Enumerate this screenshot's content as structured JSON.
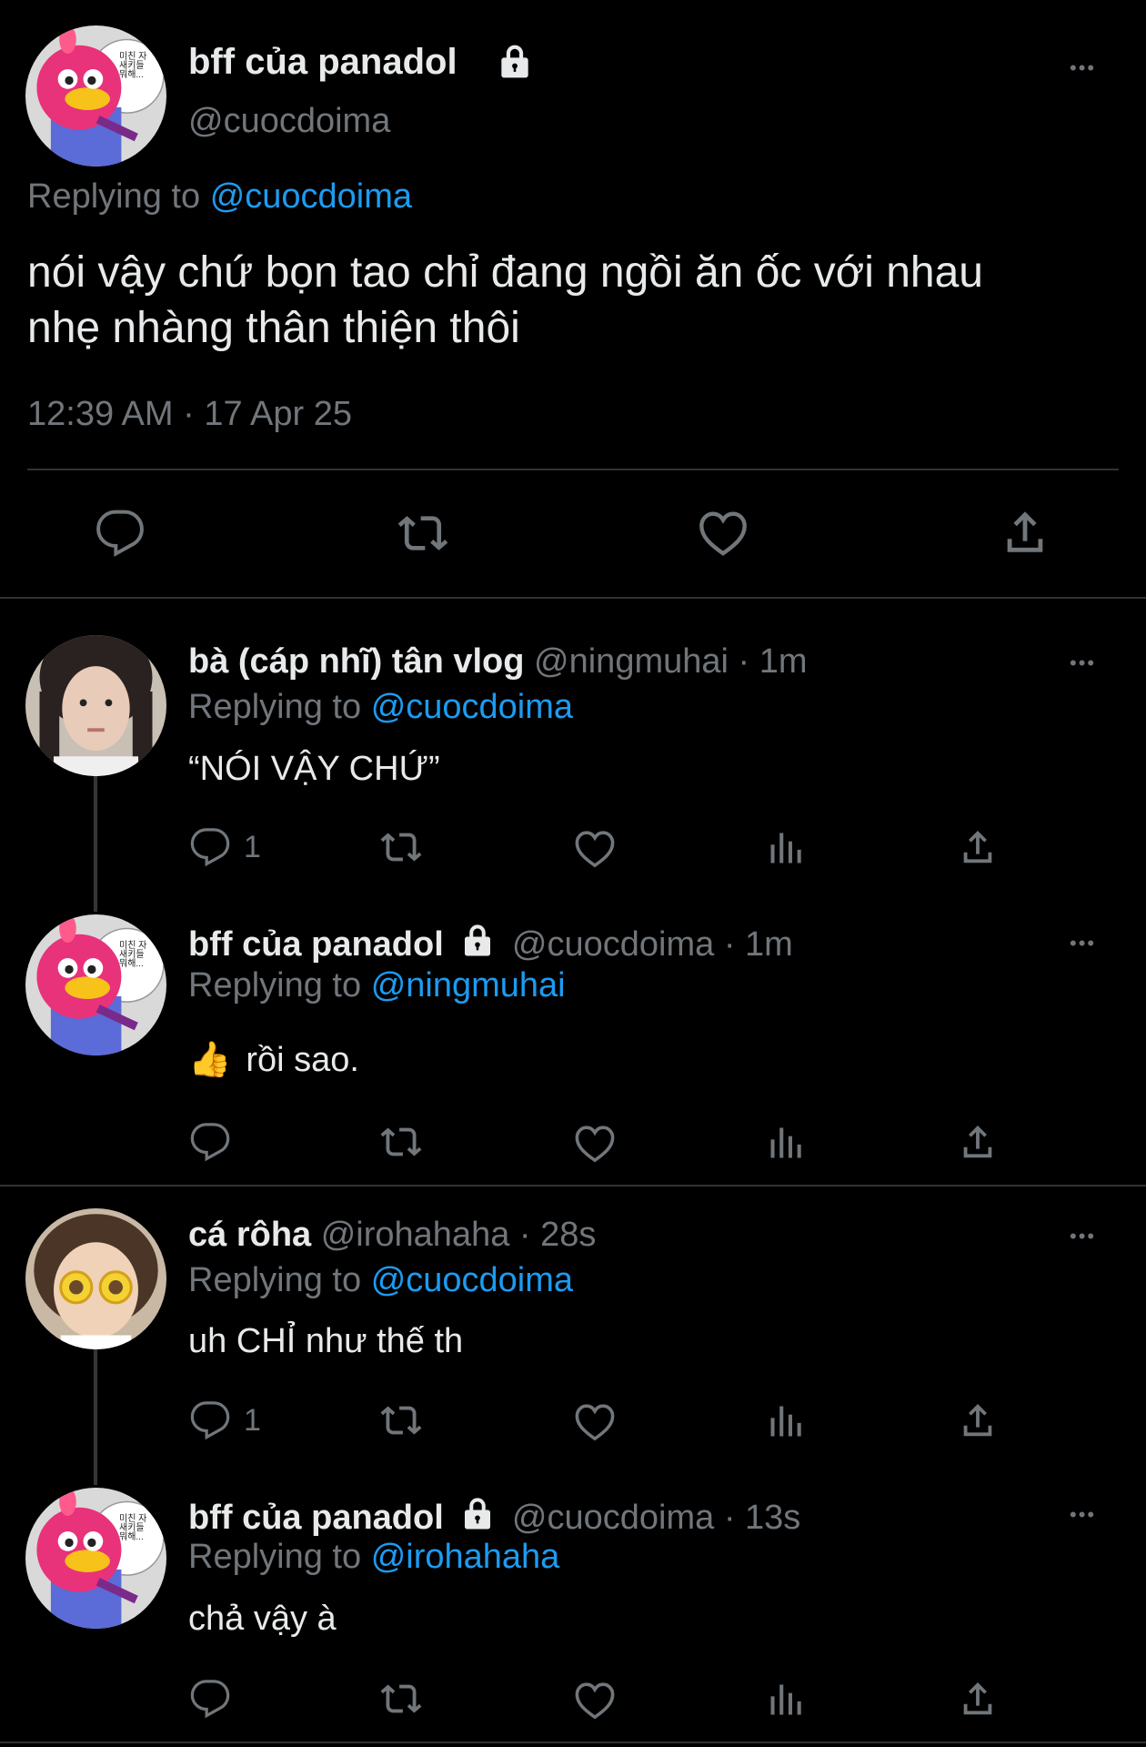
{
  "main_tweet": {
    "display_name": "bff của panadol",
    "handle": "@cuocdoima",
    "replying_prefix": "Replying to",
    "replying_to": "@cuocdoima",
    "text_line1": "nói vậy chứ bọn tao chỉ đang ngồi ăn ốc với nhau",
    "text_line2": "nhẹ nhàng thân thiện thôi",
    "timestamp": "12:39 AM · 17 Apr 25"
  },
  "avatar_bubble_text": "미친 자\n새키들\n뭐해...",
  "replies": [
    {
      "display_name": "bà (cáp nhĩ) tân vlog",
      "handle": "@ningmuhai",
      "time": "· 1m",
      "replying_prefix": "Replying to",
      "replying_to": "@cuocdoima",
      "text": "“NÓI VẬY CHỨ”",
      "reply_count": "1"
    },
    {
      "display_name": "bff của panadol",
      "handle": "@cuocdoima",
      "time": "· 1m",
      "replying_prefix": "Replying to",
      "replying_to": "@ningmuhai",
      "emoji": "👍",
      "text": "rồi sao.",
      "reply_count": ""
    },
    {
      "display_name": "cá rôha",
      "handle": "@irohahaha",
      "time": "· 28s",
      "replying_prefix": "Replying to",
      "replying_to": "@cuocdoima",
      "text": "uh CHỈ như thế th",
      "reply_count": "1"
    },
    {
      "display_name": "bff của panadol",
      "handle": "@cuocdoima",
      "time": "· 13s",
      "replying_prefix": "Replying to",
      "replying_to": "@irohahaha",
      "text": "chả vậy à",
      "reply_count": ""
    }
  ],
  "more_label": "•••",
  "colors": {
    "background": "#000000",
    "text": "#e7e9ea",
    "muted": "#71767b",
    "link": "#1d9bf0",
    "divider": "#2f3336"
  },
  "icons": [
    "reply-icon",
    "retweet-icon",
    "like-icon",
    "views-icon",
    "share-icon",
    "lock-icon",
    "more-icon"
  ]
}
